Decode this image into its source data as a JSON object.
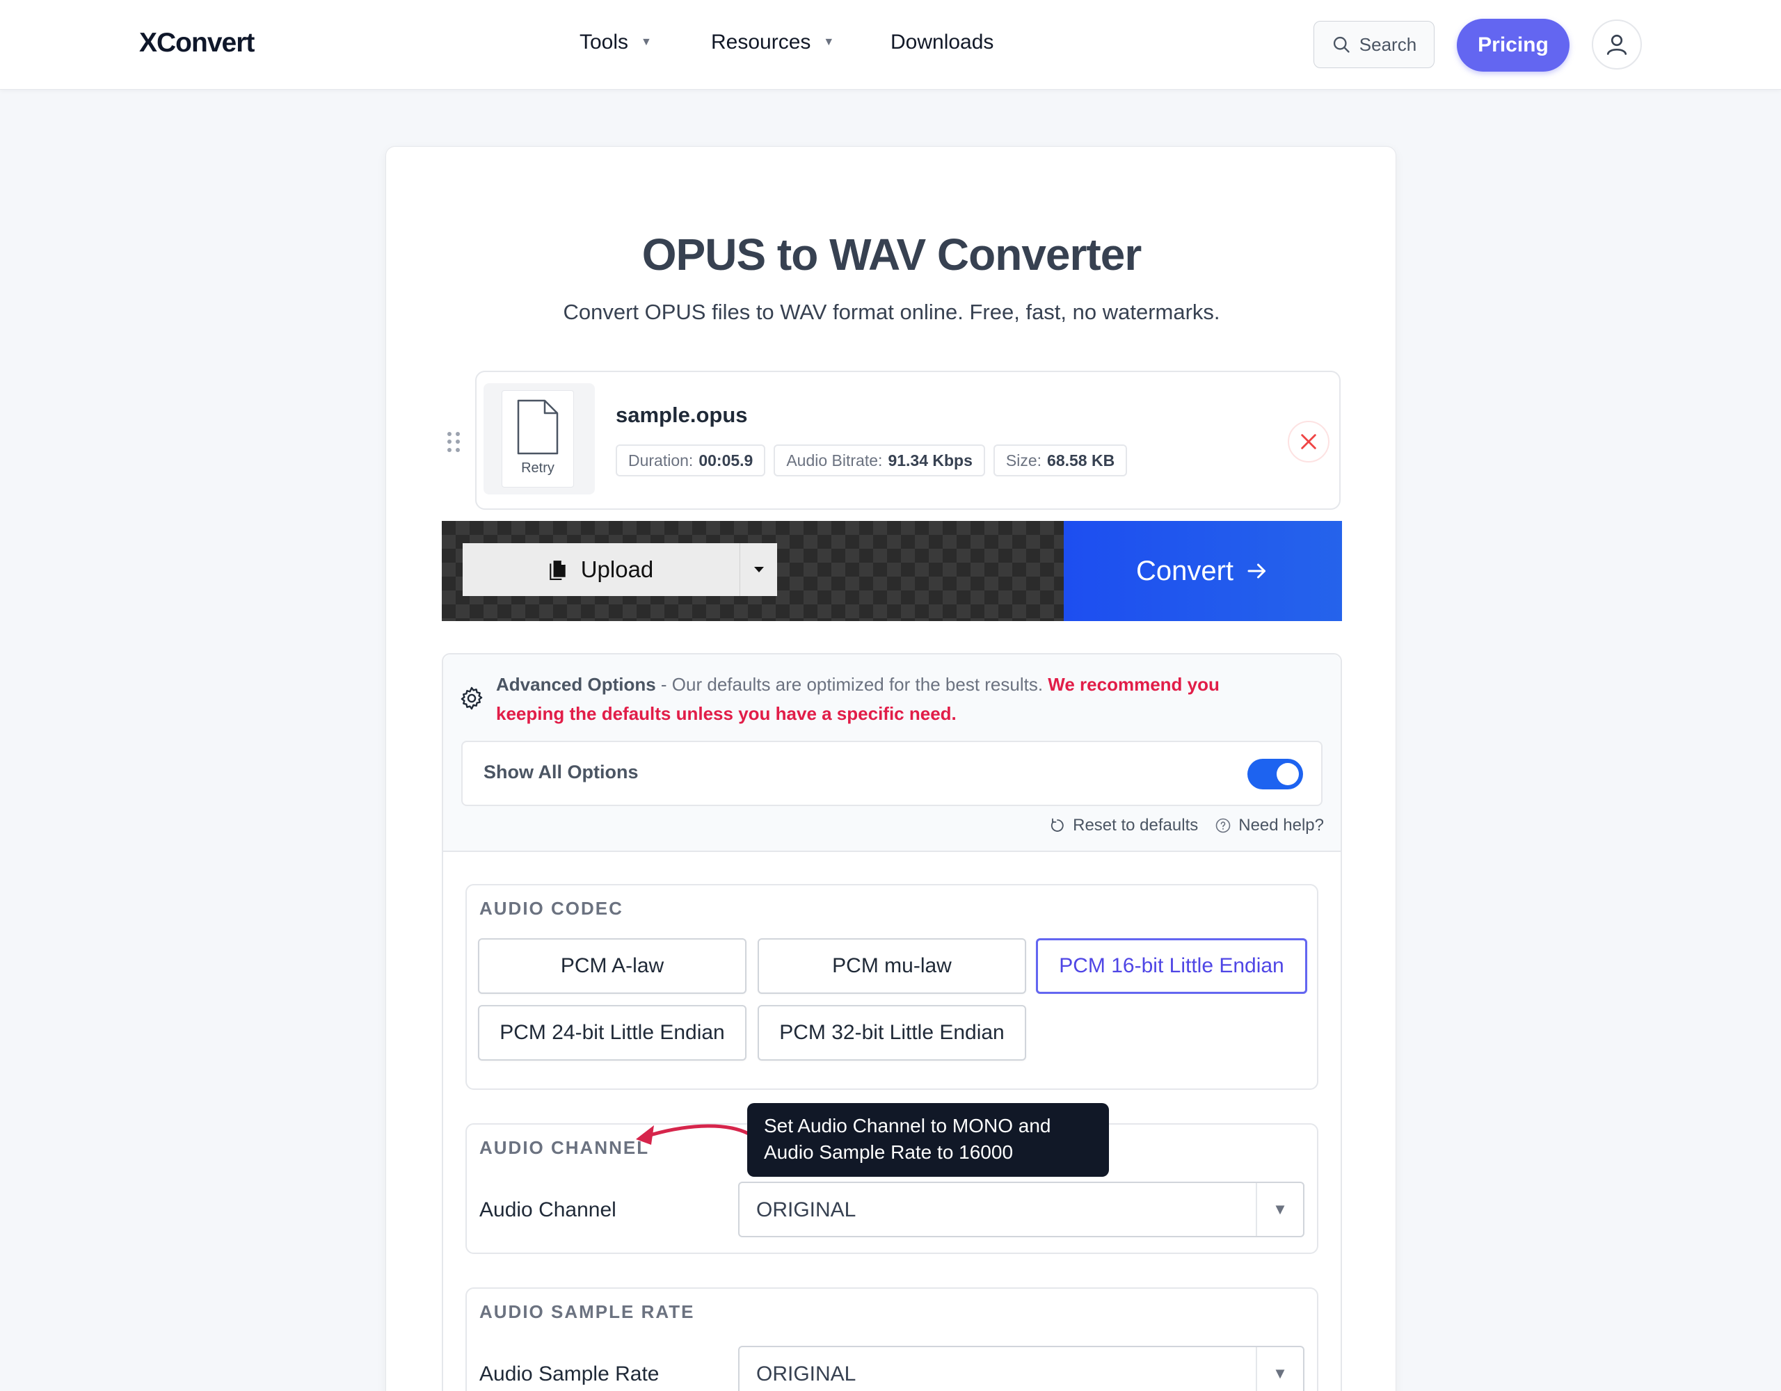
{
  "nav": {
    "logo": "XConvert",
    "items": [
      {
        "label": "Tools",
        "has_dropdown": true
      },
      {
        "label": "Resources",
        "has_dropdown": true
      },
      {
        "label": "Downloads",
        "has_dropdown": false
      }
    ],
    "search_label": "Search",
    "pricing_label": "Pricing",
    "caret": "▼"
  },
  "page": {
    "title": "OPUS to WAV Converter",
    "subtitle": "Convert OPUS files to WAV format online. Free, fast, no watermarks."
  },
  "file": {
    "name": "sample.opus",
    "retry_label": "Retry",
    "meta": [
      {
        "label": "Duration:",
        "value": "00:05.9"
      },
      {
        "label": "Audio Bitrate:",
        "value": "91.34 Kbps"
      },
      {
        "label": "Size:",
        "value": "68.58 KB"
      }
    ]
  },
  "actions": {
    "upload_label": "Upload",
    "convert_label": "Convert"
  },
  "advanced": {
    "title": "Advanced Options",
    "description": " - Our defaults are optimized for the best results. ",
    "warning": "We recommend you keeping the defaults unless you have a specific need.",
    "show_all_label": "Show All Options",
    "show_all_enabled": true,
    "reset_label": "Reset to defaults",
    "help_label": "Need help?"
  },
  "audio_codec": {
    "title": "AUDIO CODEC",
    "options": [
      {
        "label": "PCM A-law",
        "selected": false
      },
      {
        "label": "PCM mu-law",
        "selected": false
      },
      {
        "label": "PCM 16-bit Little Endian",
        "selected": true
      },
      {
        "label": "PCM 24-bit Little Endian",
        "selected": false
      },
      {
        "label": "PCM 32-bit Little Endian",
        "selected": false
      }
    ]
  },
  "audio_channel": {
    "title": "AUDIO CHANNEL",
    "field_label": "Audio Channel",
    "value": "ORIGINAL",
    "arrow": "▼"
  },
  "audio_sample_rate": {
    "title": "AUDIO SAMPLE RATE",
    "field_label": "Audio Sample Rate",
    "value": "ORIGINAL",
    "arrow": "▼"
  },
  "annotation": {
    "line1": "Set Audio Channel to MONO and",
    "line2": "Audio Sample Rate to 16000"
  },
  "colors": {
    "accent": "#6366f1",
    "convert": "#1d4ef0",
    "toggle_on": "#1d63f0",
    "warning": "#e11d48",
    "annotation_arrow": "#d6254b"
  }
}
